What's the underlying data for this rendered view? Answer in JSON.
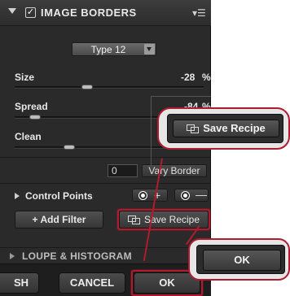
{
  "header": {
    "title": "IMAGE BORDERS",
    "checked_glyph": "✓",
    "menu_glyph": "▾☰"
  },
  "type_select": {
    "value": "Type 12"
  },
  "sliders": {
    "size": {
      "label": "Size",
      "value": "-28",
      "unit": "%"
    },
    "spread": {
      "label": "Spread",
      "value": "-84",
      "unit": "%"
    },
    "clean": {
      "label": "Clean"
    }
  },
  "vary": {
    "input_value": "0",
    "button_label": "Vary Border"
  },
  "control_points": {
    "label": "Control Points",
    "plus": "+",
    "minus": "—"
  },
  "actions": {
    "add_filter": "+ Add Filter",
    "save_recipe": "Save Recipe"
  },
  "loupe": {
    "title": "LOUPE & HISTOGRAM"
  },
  "footer": {
    "left_partial": "SH",
    "cancel": "CANCEL",
    "ok": "OK"
  },
  "callouts": {
    "save_recipe": "Save Recipe",
    "ok": "OK"
  },
  "colors": {
    "highlight": "#b01c2e",
    "panel_bg": "#2a2a2a"
  }
}
